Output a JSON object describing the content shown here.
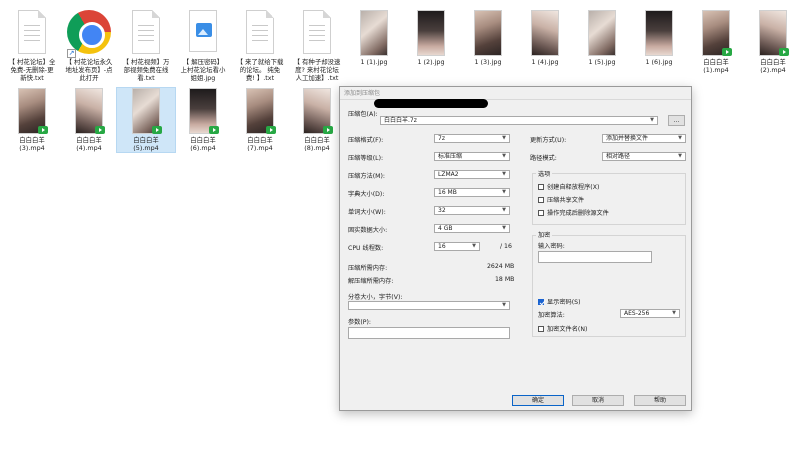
{
  "desktop": {
    "row1": [
      {
        "name": "【 村花论坛】全免费-无删除-更新快.txt",
        "label": "【 村花论坛】全\n免费-无删除-更\n新快.txt",
        "type": "doc"
      },
      {
        "name": "【 村花论坛永久地址发布页】-点此打开",
        "label": "【 村花论坛永久\n地址发布页】-点\n此打开",
        "type": "chrome"
      },
      {
        "name": "【 村花视频】万部视频免费在线看.txt",
        "label": "【 村花视频】万\n部视频免费在线\n看.txt",
        "type": "doc"
      },
      {
        "name": "【 解压密码】上村花论坛看小姐姐.jpg",
        "label": "【 解压密码】\n上村花论坛看小\n姐姐.jpg",
        "type": "image"
      },
      {
        "name": "【 来了就给下载的论坛。 纯免费! 】.txt",
        "label": "【 来了就给下载\n的论坛。 纯免\n费! 】.txt",
        "type": "doc"
      },
      {
        "name": "【 有种子却没速度? 来村花论坛人工加速】.txt",
        "label": "【 有种子却没速\n度? 来村花论坛\n人工加速】.txt",
        "type": "doc"
      },
      {
        "name": "1 (1).jpg",
        "label": "1 (1).jpg",
        "type": "thumb"
      },
      {
        "name": "1 (2).jpg",
        "label": "1 (2).jpg",
        "type": "thumb"
      },
      {
        "name": "1 (3).jpg",
        "label": "1 (3).jpg",
        "type": "thumb"
      },
      {
        "name": "1 (4).jpg",
        "label": "1 (4).jpg",
        "type": "thumb"
      },
      {
        "name": "1 (5).jpg",
        "label": "1 (5).jpg",
        "type": "thumb"
      },
      {
        "name": "1 (6).jpg",
        "label": "1 (6).jpg",
        "type": "thumb"
      },
      {
        "name": "白白白羊 (1).mp4",
        "label": "白白白羊\n(1).mp4",
        "type": "video"
      },
      {
        "name": "白白白羊 (2).mp4",
        "label": "白白白羊\n(2).mp4",
        "type": "video"
      }
    ],
    "row2": [
      {
        "name": "白白白羊 (3).mp4",
        "label": "白白白羊\n(3).mp4",
        "type": "video"
      },
      {
        "name": "白白白羊 (4).mp4",
        "label": "白白白羊\n(4).mp4",
        "type": "video"
      },
      {
        "name": "白白白羊 (5).mp4",
        "label": "白白白羊\n(5).mp4",
        "type": "video",
        "selected": true
      },
      {
        "name": "白白白羊 (6).mp4",
        "label": "白白白羊\n(6).mp4",
        "type": "video"
      },
      {
        "name": "白白白羊 (7).mp4",
        "label": "白白白羊\n(7).mp4",
        "type": "video"
      },
      {
        "name": "白白白羊 (8).mp4",
        "label": "白白白羊\n(8).mp4",
        "type": "video"
      }
    ]
  },
  "dialog": {
    "title": "添加到压缩包",
    "archive_label": "压缩包(A):",
    "archive_value": "白白白羊.7z",
    "browse_label": "...",
    "format_label": "压缩格式(F):",
    "format_value": "7z",
    "level_label": "压缩等级(L):",
    "level_value": "标准压缩",
    "method_label": "压缩方法(M):",
    "method_value": "LZMA2",
    "dict_label": "字典大小(D):",
    "dict_value": "16 MB",
    "word_label": "单词大小(W):",
    "word_value": "32",
    "solid_label": "固实数据大小:",
    "solid_value": "4 GB",
    "cpu_label": "CPU 线程数:",
    "cpu_value": "16",
    "cpu_total": "/ 16",
    "mem_comp_label": "压缩所需内存:",
    "mem_comp_value": "2624 MB",
    "mem_decomp_label": "解压缩所需内存:",
    "mem_decomp_value": "18 MB",
    "volume_label": "分卷大小，字节(V):",
    "params_label": "参数(P):",
    "update_label": "更新方式(U):",
    "update_value": "添加并替换文件",
    "path_label": "路径模式:",
    "path_value": "相对路径",
    "options_title": "选项",
    "opt_sfx": "创建自释放程序(X)",
    "opt_shared": "压缩共享文件",
    "opt_delete": "操作完成后删除源文件",
    "encrypt_title": "加密",
    "password_label": "输入密码:",
    "show_password": "显示密码(S)",
    "enc_method_label": "加密算法:",
    "enc_method_value": "AES-256",
    "encrypt_names": "加密文件名(N)",
    "ok": "确定",
    "cancel": "取消",
    "help": "帮助"
  }
}
